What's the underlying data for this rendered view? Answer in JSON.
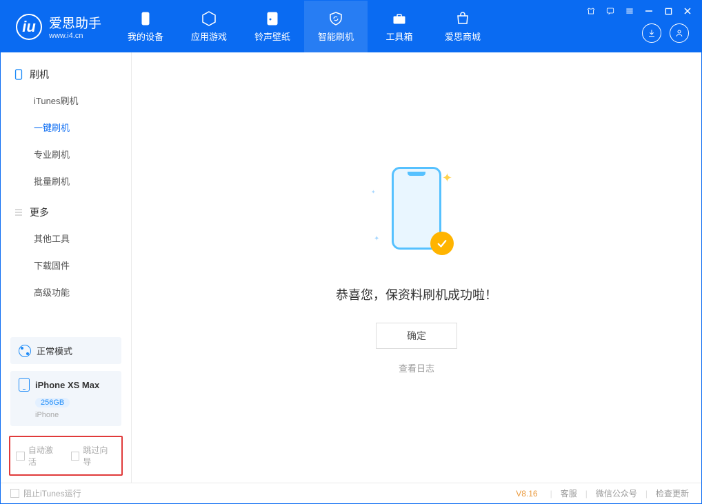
{
  "app": {
    "title": "爱思助手",
    "subtitle": "www.i4.cn"
  },
  "nav": {
    "tabs": [
      {
        "label": "我的设备"
      },
      {
        "label": "应用游戏"
      },
      {
        "label": "铃声壁纸"
      },
      {
        "label": "智能刷机"
      },
      {
        "label": "工具箱"
      },
      {
        "label": "爱思商城"
      }
    ]
  },
  "sidebar": {
    "group1": {
      "title": "刷机",
      "items": [
        {
          "label": "iTunes刷机"
        },
        {
          "label": "一键刷机"
        },
        {
          "label": "专业刷机"
        },
        {
          "label": "批量刷机"
        }
      ]
    },
    "group2": {
      "title": "更多",
      "items": [
        {
          "label": "其他工具"
        },
        {
          "label": "下载固件"
        },
        {
          "label": "高级功能"
        }
      ]
    },
    "mode_label": "正常模式",
    "device": {
      "name": "iPhone XS Max",
      "storage": "256GB",
      "type": "iPhone"
    },
    "options": {
      "auto_activate": "自动激活",
      "skip_wizard": "跳过向导"
    }
  },
  "main": {
    "success_msg": "恭喜您，保资料刷机成功啦！",
    "ok_btn": "确定",
    "log_link": "查看日志"
  },
  "footer": {
    "block_itunes": "阻止iTunes运行",
    "version": "V8.16",
    "links": [
      "客服",
      "微信公众号",
      "检查更新"
    ]
  }
}
